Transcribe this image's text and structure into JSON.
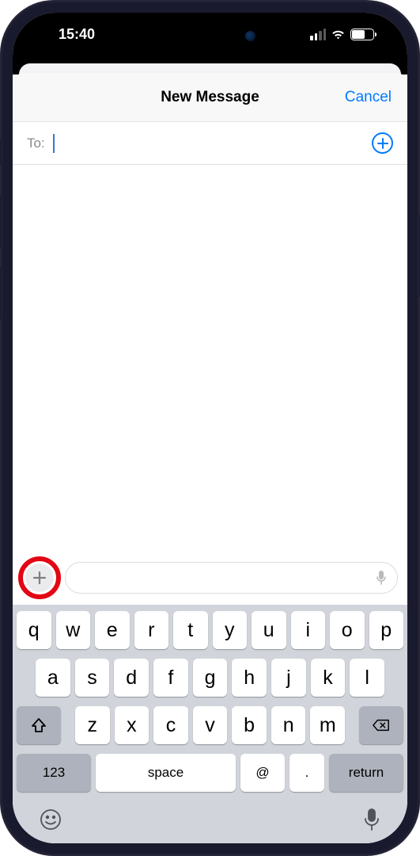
{
  "status": {
    "time": "15:40",
    "battery": "61"
  },
  "nav": {
    "title": "New Message",
    "cancel": "Cancel"
  },
  "to": {
    "label": "To:"
  },
  "keyboard": {
    "row1": [
      "q",
      "w",
      "e",
      "r",
      "t",
      "y",
      "u",
      "i",
      "o",
      "p"
    ],
    "row2": [
      "a",
      "s",
      "d",
      "f",
      "g",
      "h",
      "j",
      "k",
      "l"
    ],
    "row3": [
      "z",
      "x",
      "c",
      "v",
      "b",
      "n",
      "m"
    ],
    "numbers": "123",
    "space": "space",
    "at": "@",
    "dot": ".",
    "return": "return"
  }
}
